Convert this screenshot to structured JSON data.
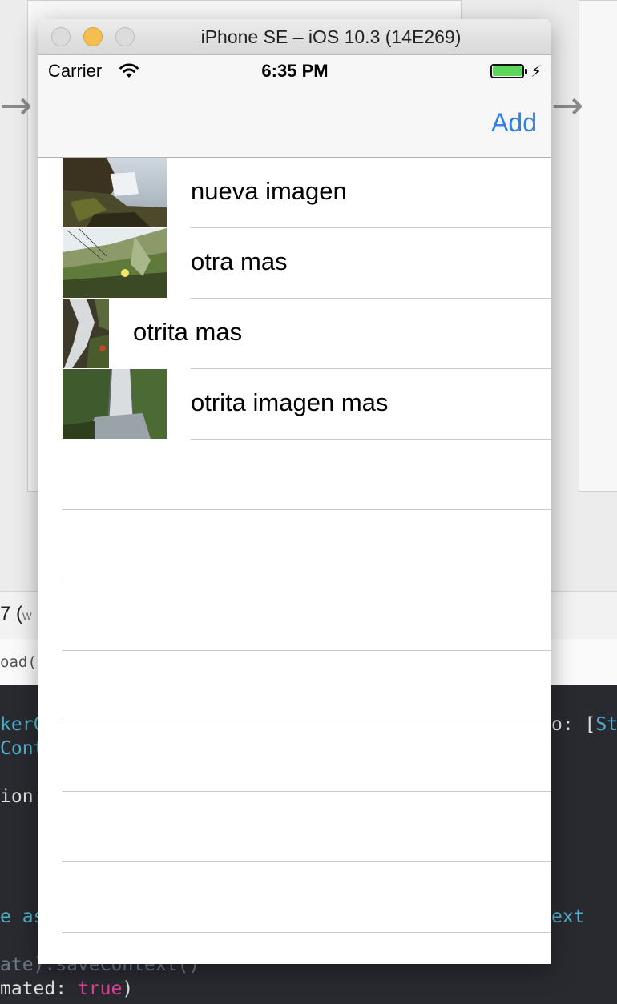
{
  "simulator": {
    "title": "iPhone SE – iOS 10.3 (14E269)"
  },
  "status_bar": {
    "carrier": "Carrier",
    "time": "6:35 PM",
    "battery_color": "#5cd65a",
    "icons": [
      "wifi-icon",
      "battery-icon",
      "charging-bolt-icon"
    ]
  },
  "nav_bar": {
    "add_label": "Add",
    "tint_color": "#2f7fe0"
  },
  "table": {
    "rows": [
      {
        "label": "nueva imagen",
        "thumbnail": "waterfall-cliff-photo"
      },
      {
        "label": "otra mas",
        "thumbnail": "hillside-flower-photo"
      },
      {
        "label": "otrita mas",
        "thumbnail": "stream-waterfall-photo"
      },
      {
        "label": "otrita imagen mas",
        "thumbnail": "tall-waterfall-photo"
      }
    ],
    "empty_row_count": 8
  },
  "background": {
    "editor_text": "7 (",
    "editor_small": "w",
    "jump_text": "oad()",
    "code_lines": [
      {
        "left": "kerC",
        "right": "o: [St"
      },
      {
        "left": "Cont",
        "right": ""
      },
      {
        "left": "ion:",
        "right": ""
      },
      {
        "left": "e as",
        "right": "ext"
      },
      {
        "left": "ate).saveContext()",
        "right": ""
      },
      {
        "left": "mated: true)",
        "right": ""
      }
    ]
  }
}
